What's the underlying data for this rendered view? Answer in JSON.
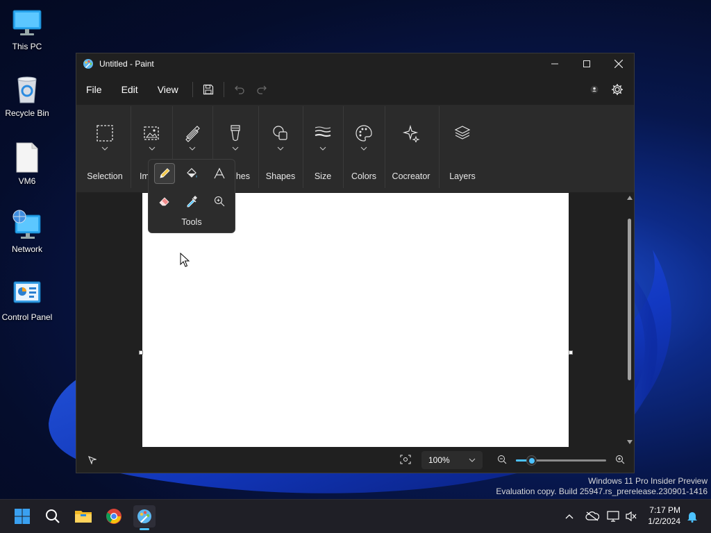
{
  "desktop": {
    "icons": [
      {
        "label": "This PC"
      },
      {
        "label": "Recycle Bin"
      },
      {
        "label": "VM6"
      },
      {
        "label": "Network"
      },
      {
        "label": "Control Panel"
      }
    ],
    "watermark_line1": "Windows 11 Pro Insider Preview",
    "watermark_line2": "Evaluation copy. Build 25947.rs_prerelease.230901-1416"
  },
  "window": {
    "title": "Untitled - Paint",
    "controls": {
      "minimize": "minimize",
      "maximize": "maximize",
      "close": "close"
    }
  },
  "menu": {
    "file": "File",
    "edit": "Edit",
    "view": "View"
  },
  "ribbon": {
    "selection": "Selection",
    "image_partial": "Im",
    "brushes_partial": "hes",
    "shapes": "Shapes",
    "size": "Size",
    "colors": "Colors",
    "cocreator": "Cocreator",
    "layers": "Layers"
  },
  "tools_flyout": {
    "label": "Tools",
    "tools": [
      "pencil-icon",
      "fill-icon",
      "text-icon",
      "eraser-icon",
      "color-picker-icon",
      "magnifier-icon"
    ],
    "selected": "pencil-icon"
  },
  "status": {
    "zoom_value": "100%",
    "zoom_slider_level": 0.17
  },
  "taskbar": {
    "apps": [
      "start-icon",
      "search-icon",
      "file-explorer-icon",
      "chrome-icon",
      "paint-icon"
    ],
    "active_app": "paint-icon",
    "time": "7:17 PM",
    "date": "1/2/2024"
  },
  "colors": {
    "accent": "#4cc2ff"
  }
}
